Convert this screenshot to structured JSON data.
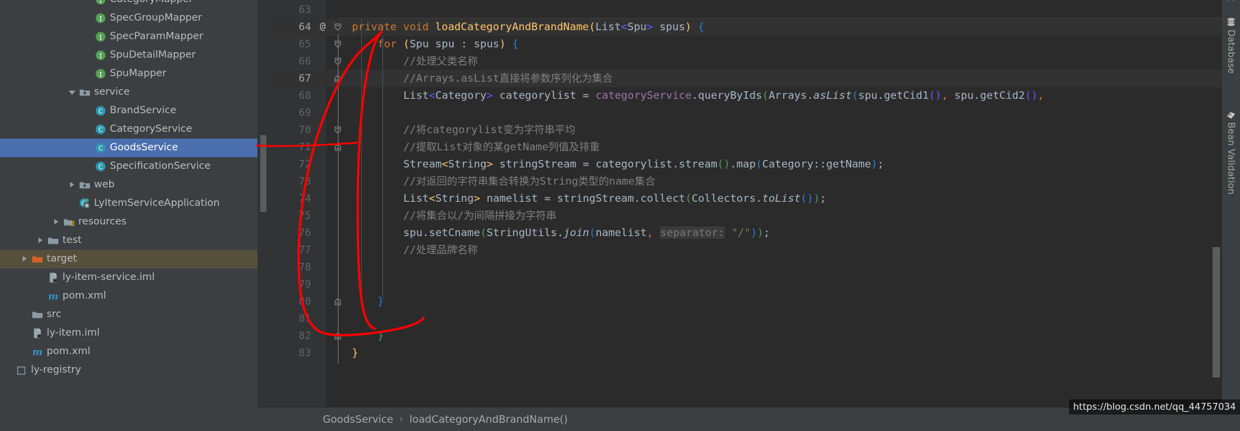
{
  "project_tree": {
    "items": [
      {
        "label": "CategoryMapper",
        "icon": "interface-icon",
        "indent": 5,
        "arrow": "none",
        "selected": false,
        "clipped": true
      },
      {
        "label": "SpecGroupMapper",
        "icon": "interface-icon",
        "indent": 5,
        "arrow": "none",
        "selected": false
      },
      {
        "label": "SpecParamMapper",
        "icon": "interface-icon",
        "indent": 5,
        "arrow": "none",
        "selected": false
      },
      {
        "label": "SpuDetailMapper",
        "icon": "interface-icon",
        "indent": 5,
        "arrow": "none",
        "selected": false
      },
      {
        "label": "SpuMapper",
        "icon": "interface-icon",
        "indent": 5,
        "arrow": "none",
        "selected": false
      },
      {
        "label": "service",
        "icon": "package-folder-icon",
        "indent": 4,
        "arrow": "down",
        "selected": false
      },
      {
        "label": "BrandService",
        "icon": "class-icon",
        "indent": 5,
        "arrow": "none",
        "selected": false
      },
      {
        "label": "CategoryService",
        "icon": "class-icon",
        "indent": 5,
        "arrow": "none",
        "selected": false
      },
      {
        "label": "GoodsService",
        "icon": "class-icon",
        "indent": 5,
        "arrow": "none",
        "selected": true
      },
      {
        "label": "SpecificationService",
        "icon": "class-icon",
        "indent": 5,
        "arrow": "none",
        "selected": false
      },
      {
        "label": "web",
        "icon": "package-folder-icon",
        "indent": 4,
        "arrow": "right",
        "selected": false
      },
      {
        "label": "LyItemServiceApplication",
        "icon": "spring-class-icon",
        "indent": 4,
        "arrow": "none",
        "selected": false
      },
      {
        "label": "resources",
        "icon": "resources-folder-icon",
        "indent": 3,
        "arrow": "right",
        "selected": false
      },
      {
        "label": "test",
        "icon": "folder-icon",
        "indent": 2,
        "arrow": "right",
        "selected": false
      },
      {
        "label": "target",
        "icon": "excluded-folder-icon",
        "indent": 1,
        "arrow": "right",
        "selected": false,
        "highlighted": true
      },
      {
        "label": "ly-item-service.iml",
        "icon": "iml-file-icon",
        "indent": 2,
        "arrow": "none",
        "selected": false
      },
      {
        "label": "pom.xml",
        "icon": "maven-icon",
        "indent": 2,
        "arrow": "none",
        "selected": false
      },
      {
        "label": "src",
        "icon": "folder-icon",
        "indent": 1,
        "arrow": "none",
        "selected": false
      },
      {
        "label": "ly-item.iml",
        "icon": "iml-file-icon",
        "indent": 1,
        "arrow": "none",
        "selected": false
      },
      {
        "label": "pom.xml",
        "icon": "maven-icon",
        "indent": 1,
        "arrow": "none",
        "selected": false
      },
      {
        "label": "ly-registry",
        "icon": "module-icon",
        "indent": 0,
        "arrow": "none",
        "selected": false,
        "clipped": true
      }
    ]
  },
  "editor": {
    "lines": [
      {
        "num": "63",
        "at": "",
        "fold": "",
        "current": false,
        "highlight": false
      },
      {
        "num": "64",
        "at": "@",
        "fold": "collapse",
        "current": true,
        "highlight": false
      },
      {
        "num": "65",
        "at": "",
        "fold": "collapse",
        "current": false,
        "highlight": false
      },
      {
        "num": "66",
        "at": "",
        "fold": "collapse",
        "current": false,
        "highlight": false
      },
      {
        "num": "67",
        "at": "",
        "fold": "collapse-end",
        "current": true,
        "highlight": true
      },
      {
        "num": "68",
        "at": "",
        "fold": "",
        "current": false,
        "highlight": false
      },
      {
        "num": "69",
        "at": "",
        "fold": "",
        "current": false,
        "highlight": false
      },
      {
        "num": "70",
        "at": "",
        "fold": "collapse",
        "current": false,
        "highlight": false
      },
      {
        "num": "71",
        "at": "",
        "fold": "collapse-end",
        "current": false,
        "highlight": false
      },
      {
        "num": "72",
        "at": "",
        "fold": "",
        "current": false,
        "highlight": false
      },
      {
        "num": "73",
        "at": "",
        "fold": "",
        "current": false,
        "highlight": false
      },
      {
        "num": "74",
        "at": "",
        "fold": "",
        "current": false,
        "highlight": false
      },
      {
        "num": "75",
        "at": "",
        "fold": "",
        "current": false,
        "highlight": false
      },
      {
        "num": "76",
        "at": "",
        "fold": "",
        "current": false,
        "highlight": false
      },
      {
        "num": "77",
        "at": "",
        "fold": "",
        "current": false,
        "highlight": false
      },
      {
        "num": "78",
        "at": "",
        "fold": "",
        "current": false,
        "highlight": false
      },
      {
        "num": "79",
        "at": "",
        "fold": "",
        "current": false,
        "highlight": false
      },
      {
        "num": "80",
        "at": "",
        "fold": "collapse-end",
        "current": false,
        "highlight": false
      },
      {
        "num": "81",
        "at": "",
        "fold": "",
        "current": false,
        "highlight": false
      },
      {
        "num": "82",
        "at": "",
        "fold": "collapse-end",
        "current": false,
        "highlight": false
      },
      {
        "num": "83",
        "at": "",
        "fold": "",
        "current": false,
        "highlight": false
      }
    ],
    "source": {
      "l63": "",
      "l64": "private void loadCategoryAndBrandName(List<Spu> spus) {",
      "l65": "    for (Spu spu : spus) {",
      "l66": "        //处理父类名称",
      "l67": "        //Arrays.asList直接将参数序列化为集合",
      "l68": "        List<Category> categorylist = categoryService.queryByIds(Arrays.asList(spu.getCid1(), spu.getCid2(),",
      "l69": "",
      "l70": "        //将categorylist变为字符串平均",
      "l71": "        //提取List对象的某getName列值及排重",
      "l72": "        Stream<String> stringStream = categorylist.stream().map(Category::getName);",
      "l73": "        //对返回的字符串集合转换为String类型的name集合",
      "l74": "        List<String> namelist = stringStream.collect(Collectors.toList());",
      "l75": "        //将集合以/为间隔拼接为字符串",
      "l76": "        spu.setCname(StringUtils.join(namelist, separator: \"/\"));",
      "l77": "        //处理品牌名称",
      "l78": "",
      "l79": "",
      "l80": "    }",
      "l81": "",
      "l82": "    }",
      "l83": "}"
    },
    "param_hint_76": "separator:"
  },
  "breadcrumb": {
    "class": "GoodsService",
    "separator": "›",
    "method": "loadCategoryAndBrandName()"
  },
  "tool_strip": {
    "items": [
      {
        "label": "t",
        "icon": "clipped-icon"
      },
      {
        "label": "Database",
        "icon": "database-icon"
      },
      {
        "label": "Bean Validation",
        "icon": "bean-validation-icon"
      }
    ]
  },
  "watermark": {
    "text": "https://blog.csdn.net/qq_44757034"
  },
  "annotation": {
    "color": "#ff0000",
    "description": "hand-drawn red loop around the for-loop body"
  },
  "colors": {
    "selection": "#4b6eaf",
    "tree_bg": "#3c3f41",
    "editor_bg": "#2b2b2b",
    "gutter_bg": "#313335",
    "keyword": "#cc7832",
    "method": "#ffc66d",
    "comment": "#808080",
    "string": "#6a8759",
    "field": "#9876aa",
    "number": "#6897bb"
  }
}
